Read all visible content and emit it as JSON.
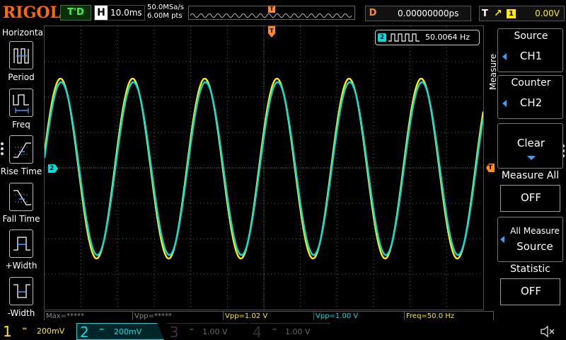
{
  "brand": "RIGOL",
  "run_state": "T'D",
  "timebase": {
    "label": "H",
    "value": "10.0ms"
  },
  "sampling": {
    "rate": "50.0MSa/s",
    "points": "6.00M pts"
  },
  "horizontal_trigger_marker": "T",
  "delay": {
    "label": "D",
    "value": "0.00000000ps"
  },
  "trigger": {
    "label": "T",
    "source": "1",
    "level": "0.00V",
    "edge_icon": "rising-edge-icon"
  },
  "left_menu": {
    "title": "Horizontal",
    "items": [
      {
        "label": "Period",
        "icon": "period-icon"
      },
      {
        "label": "Freq",
        "icon": "frequency-icon"
      },
      {
        "label": "Rise Time",
        "icon": "rise-time-icon"
      },
      {
        "label": "Fall Time",
        "icon": "fall-time-icon"
      },
      {
        "label": "+Width",
        "icon": "positive-width-icon"
      },
      {
        "label": "-Width",
        "icon": "negative-width-icon"
      }
    ]
  },
  "counter": {
    "channel": "2",
    "value": "50.0064 Hz",
    "icon": "square-wave-icon"
  },
  "markers": {
    "ch2": "2",
    "trigger_level": "T"
  },
  "measurements": [
    {
      "text": "Max=*****",
      "color": "#888888"
    },
    {
      "text": "Vpp=*****",
      "color": "#888888"
    },
    {
      "text": "Vpp=1.02 V",
      "color": "#ffea00"
    },
    {
      "text": "Vpp=1.00 V",
      "color": "#00e0e0"
    },
    {
      "text": "Freq=50.0 Hz",
      "color": "#ffea00"
    }
  ],
  "channels": [
    {
      "num": "1",
      "scale": "200mV",
      "color": "#ffea00",
      "active": true
    },
    {
      "num": "2",
      "scale": "200mV",
      "color": "#00e0e0",
      "active": true
    },
    {
      "num": "3",
      "scale": "1.00 V",
      "color": "#666666",
      "active": false
    },
    {
      "num": "4",
      "scale": "1.00 V",
      "color": "#666666",
      "active": false
    }
  ],
  "right_menu": {
    "title": "Measure",
    "source": {
      "label": "Source",
      "value": "CH1"
    },
    "counter": {
      "label": "Counter",
      "value": "CH2"
    },
    "clear": {
      "label": "Clear"
    },
    "measure_all": {
      "label": "Measure All",
      "value": "OFF"
    },
    "all_measure_source": {
      "line1": "All Measure",
      "line2": "Source"
    },
    "statistic": {
      "label": "Statistic",
      "value": "OFF"
    }
  },
  "colors": {
    "ch1": "#ffea00",
    "ch2": "#00e0e0",
    "trigger": "#ff8c1a",
    "brand": "#ff6a00"
  }
}
